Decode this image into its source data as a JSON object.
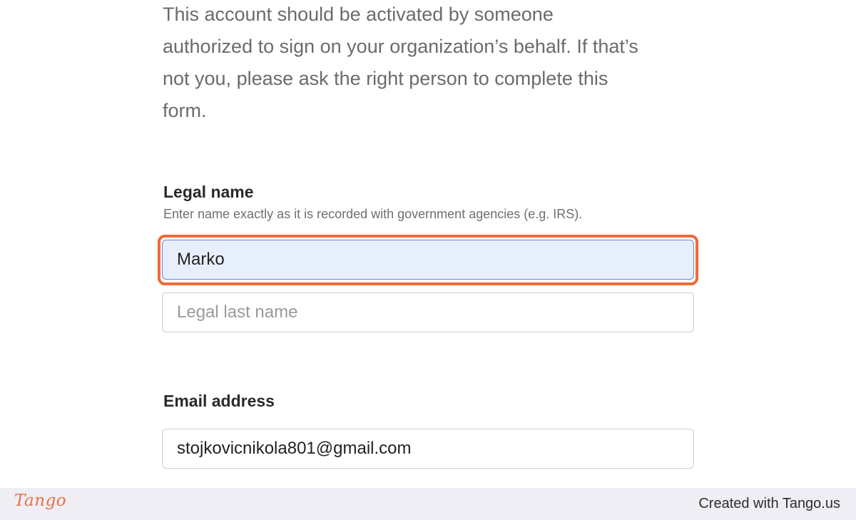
{
  "intro": {
    "line1": "This account should be activated by someone",
    "line2": "authorized to sign on your organization’s behalf. If that’s",
    "line3": "not you, please ask the right person to complete this",
    "line4": "form."
  },
  "legal_name": {
    "label": "Legal name",
    "hint": "Enter name exactly as it is recorded with government agencies (e.g. IRS).",
    "first_name_value": "Marko",
    "last_name_placeholder": "Legal last name"
  },
  "email": {
    "label": "Email address",
    "value": "stojkovicnikola801@gmail.com"
  },
  "footer": {
    "logo_text": "Tango",
    "created_text": "Created with Tango.us"
  },
  "colors": {
    "highlight": "#f26b3a",
    "autofill_bg": "#e8effc",
    "footer_bg": "#efeef4",
    "logo": "#e8704a"
  }
}
